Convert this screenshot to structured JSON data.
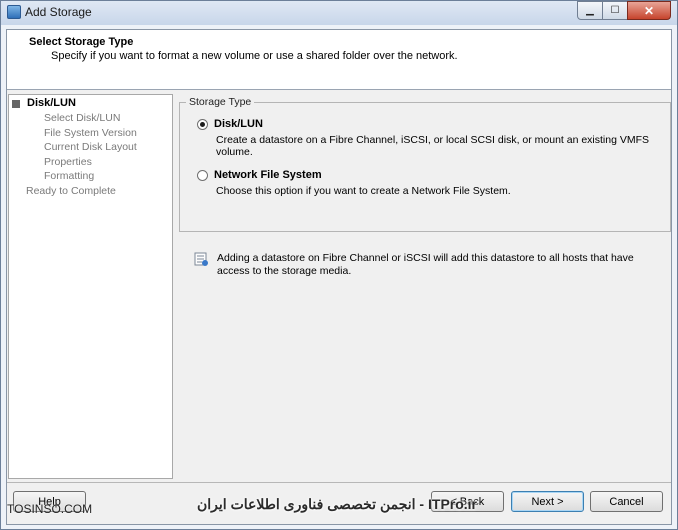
{
  "window": {
    "title": "Add Storage",
    "controls": {
      "minimize": "▁",
      "maximize": "☐",
      "close": "✕"
    }
  },
  "header": {
    "title": "Select Storage Type",
    "subtitle": "Specify if you want to format a new volume or use a shared folder over the network."
  },
  "nav": {
    "items": [
      {
        "label": "Disk/LUN",
        "active": true
      },
      {
        "label": "Select Disk/LUN",
        "active": false
      },
      {
        "label": "File System Version",
        "active": false
      },
      {
        "label": "Current Disk Layout",
        "active": false
      },
      {
        "label": "Properties",
        "active": false
      },
      {
        "label": "Formatting",
        "active": false
      },
      {
        "label": "Ready to Complete",
        "active": false
      }
    ]
  },
  "storage_type": {
    "legend": "Storage Type",
    "options": [
      {
        "label": "Disk/LUN",
        "description": "Create a datastore on a Fibre Channel, iSCSI, or local SCSI disk, or mount an existing VMFS volume.",
        "selected": true
      },
      {
        "label": "Network File System",
        "description": "Choose this option if you want to create a Network File System.",
        "selected": false
      }
    ]
  },
  "info": {
    "icon": "info-note-icon",
    "text": "Adding a datastore on Fibre Channel or iSCSI will add this datastore to all hosts that have access to the storage media."
  },
  "buttons": {
    "help": "Help",
    "back": "≤ Back",
    "next": "Next >",
    "cancel": "Cancel"
  },
  "watermark": {
    "left": "TOSINSO.COM",
    "right": "ITPro.ir - انجمن تخصصی فناوری اطلاعات ایران"
  },
  "colors": {
    "titlebar": "#c8d6ea",
    "client_bg": "#f0f0f0",
    "panel_bg": "#ffffff",
    "default_button_border": "#3c7fb1"
  }
}
